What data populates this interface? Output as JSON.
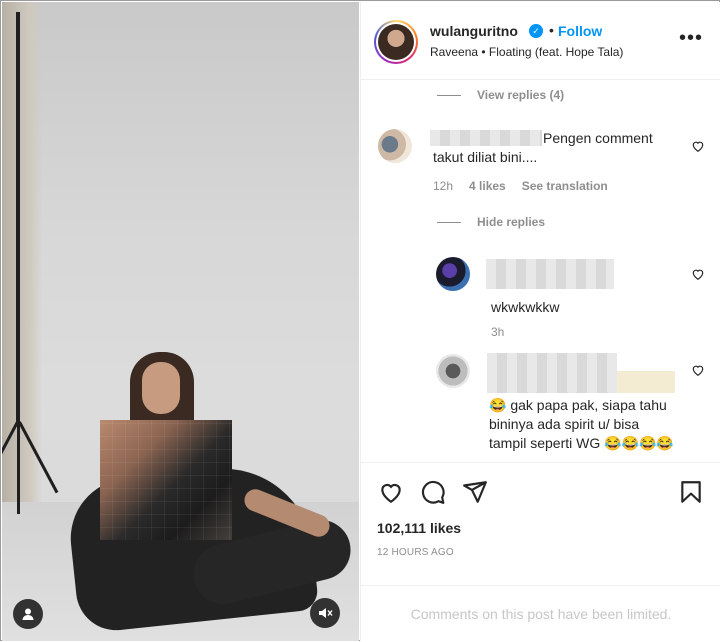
{
  "post": {
    "username": "wulanguritno",
    "follow_label": "Follow",
    "dot": "•",
    "audio": "Raveena • Floating (feat. Hope Tala)",
    "more": "•••"
  },
  "comments": {
    "view_replies": "View replies (4)",
    "hide_replies": "Hide replies",
    "main": {
      "text": "Pengen comment takut diliat bini....",
      "time": "12h",
      "likes": "4 likes",
      "see_translation": "See translation"
    },
    "replies": [
      {
        "text": "wkwkwkkw",
        "time": "3h"
      },
      {
        "text": "😂 gak papa pak, siapa tahu bininya ada spirit u/ bisa tampil seperti WG 😂😂😂😂"
      }
    ]
  },
  "actions": {
    "likes": "102,111 likes",
    "time": "12 HOURS AGO"
  },
  "footer": {
    "limited": "Comments on this post have been limited."
  },
  "icons": [
    "user-icon",
    "mute-icon",
    "verified-icon",
    "more-icon",
    "heart-icon",
    "comment-icon",
    "share-icon",
    "bookmark-icon"
  ],
  "colors": {
    "accent": "#0095f6",
    "text": "#262626",
    "muted": "#8e8e8e"
  }
}
